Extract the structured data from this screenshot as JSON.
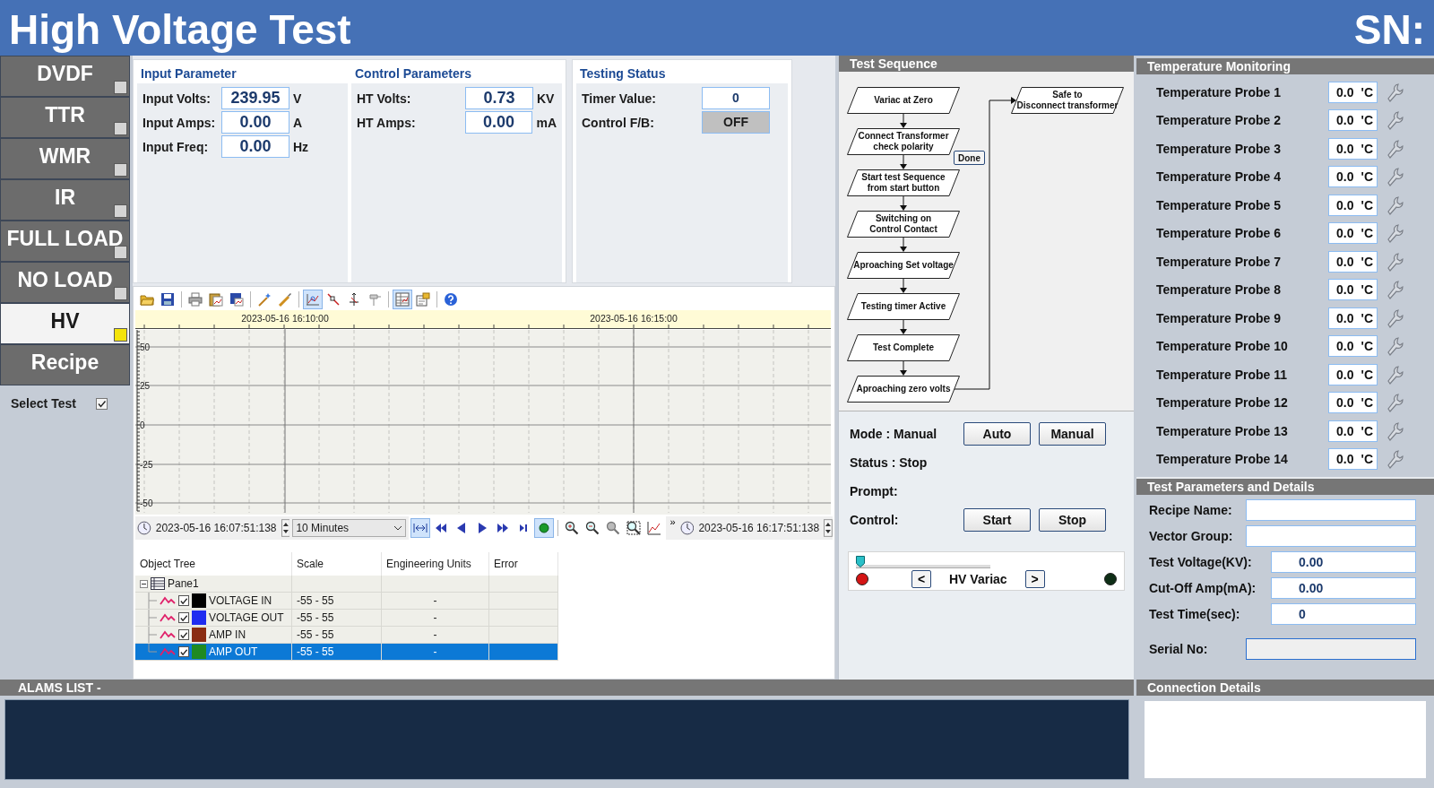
{
  "header": {
    "title": "High Voltage Test",
    "serial_label": "SN:"
  },
  "nav": {
    "items": [
      {
        "label": "DVDF",
        "kind": "test",
        "selected": false
      },
      {
        "label": "TTR",
        "kind": "test",
        "selected": false
      },
      {
        "label": "WMR",
        "kind": "test",
        "selected": false
      },
      {
        "label": "IR",
        "kind": "test",
        "selected": false
      },
      {
        "label": "FULL LOAD",
        "kind": "test",
        "selected": false
      },
      {
        "label": "NO LOAD",
        "kind": "test",
        "selected": false
      },
      {
        "label": "HV",
        "kind": "test",
        "selected": true
      },
      {
        "label": "Recipe",
        "kind": "page",
        "selected": false
      }
    ],
    "select_test": {
      "label": "Select Test",
      "checked": true
    }
  },
  "input_parameter": {
    "title": "Input Parameter",
    "rows": [
      {
        "label": "Input Volts:",
        "value": "239.95",
        "unit": "V"
      },
      {
        "label": "Input Amps:",
        "value": "0.00",
        "unit": "A"
      },
      {
        "label": "Input Freq:",
        "value": "0.00",
        "unit": "Hz"
      }
    ]
  },
  "control_parameters": {
    "title": "Control Parameters",
    "rows": [
      {
        "label": "HT Volts:",
        "value": "0.73",
        "unit": "KV"
      },
      {
        "label": "HT Amps:",
        "value": "0.00",
        "unit": "mA"
      }
    ]
  },
  "testing_status": {
    "title": "Testing Status",
    "rows": [
      {
        "label": "Timer Value:",
        "value": "0",
        "kind": "field"
      },
      {
        "label": "Control F/B:",
        "value": "OFF",
        "kind": "lamp",
        "on": false
      }
    ]
  },
  "trend": {
    "toolbar": [
      {
        "kind": "folder",
        "pressed": false,
        "sep": false
      },
      {
        "kind": "save",
        "pressed": false,
        "sep": false
      },
      {
        "kind": "printer",
        "pressed": false,
        "sep": true
      },
      {
        "kind": "clipboard",
        "pressed": false,
        "sep": false
      },
      {
        "kind": "diskchart",
        "pressed": false,
        "sep": false
      },
      {
        "kind": "wand",
        "pressed": false,
        "sep": true
      },
      {
        "kind": "pen",
        "pressed": false,
        "sep": false
      },
      {
        "kind": "cursor",
        "pressed": true,
        "sep": true
      },
      {
        "kind": "line",
        "pressed": false,
        "sep": false
      },
      {
        "kind": "axis",
        "pressed": false,
        "sep": false
      },
      {
        "kind": "pin",
        "pressed": false,
        "sep": false
      },
      {
        "kind": "table",
        "pressed": true,
        "sep": true
      },
      {
        "kind": "props",
        "pressed": false,
        "sep": false
      },
      {
        "kind": "help",
        "pressed": false,
        "sep": true
      }
    ],
    "time_labels": [
      "2023-05-16 16:10:00",
      "2023-05-16 16:15:00"
    ],
    "y_labels": [
      "50",
      "25",
      "0",
      "-25",
      "-50"
    ],
    "start_time": "2023-05-16 16:07:51:138",
    "range": "10 Minutes",
    "nav_buttons": [
      {
        "kind": "fit",
        "pressed": true,
        "sep": false
      },
      {
        "kind": "first",
        "pressed": false,
        "sep": false
      },
      {
        "kind": "prev",
        "pressed": false,
        "sep": false
      },
      {
        "kind": "next",
        "pressed": false,
        "sep": false
      },
      {
        "kind": "fast",
        "pressed": false,
        "sep": false
      },
      {
        "kind": "last",
        "pressed": false,
        "sep": false
      },
      {
        "kind": "live",
        "pressed": true,
        "sep": false
      },
      {
        "kind": "zoomin",
        "pressed": false,
        "sep": true
      },
      {
        "kind": "zoomout",
        "pressed": false,
        "sep": false
      },
      {
        "kind": "zoomkey",
        "pressed": false,
        "sep": false
      },
      {
        "kind": "zoombox",
        "pressed": false,
        "sep": false
      },
      {
        "kind": "chartfit",
        "pressed": false,
        "sep": false
      }
    ],
    "more": "»",
    "end_time": "2023-05-16 16:17:51:138",
    "tree": {
      "columns": [
        "Object Tree",
        "Scale",
        "Engineering Units",
        "Error"
      ],
      "root": {
        "label": "Pane1",
        "expanded": true,
        "children": [
          {
            "label": "VOLTAGE IN",
            "checked": true,
            "color": "#000000",
            "scale": "-55 - 55",
            "units": "-",
            "selected": false
          },
          {
            "label": "VOLTAGE OUT",
            "checked": true,
            "color": "#1f2cf0",
            "scale": "-55 - 55",
            "units": "-",
            "selected": false
          },
          {
            "label": "AMP IN",
            "checked": true,
            "color": "#8a2c12",
            "scale": "-55 - 55",
            "units": "-",
            "selected": false
          },
          {
            "label": "AMP OUT",
            "checked": true,
            "color": "#1f8a22",
            "scale": "-55 - 55",
            "units": "-",
            "selected": true
          }
        ]
      }
    }
  },
  "test_sequence": {
    "title": "Test Sequence",
    "steps": [
      "Variac at Zero",
      "Connect Transformer\ncheck polarity",
      "Start test Sequence\nfrom start button",
      "Switching on\nControl Contact",
      "Aproaching Set voltage",
      "Testing timer Active",
      "Test Complete",
      "Aproaching zero volts"
    ],
    "final_step": "Safe to\nDisconnect transformer",
    "done_button": "Done",
    "mode_label": "Mode : Manual",
    "mode_buttons": [
      "Auto",
      "Manual"
    ],
    "status": "Status : Stop",
    "prompt": "Prompt:",
    "control_label": "Control:",
    "control_buttons": [
      "Start",
      "Stop"
    ],
    "variac": {
      "label": "HV Variac",
      "level": 0,
      "down": "<",
      "up": ">",
      "lamps": [
        {
          "color": "#d41414"
        },
        {
          "color": "#0e2e16"
        }
      ]
    }
  },
  "temperature_monitoring": {
    "title": "Temperature Monitoring",
    "probes": [
      {
        "label": "Temperature Probe 1",
        "value": "0.0",
        "unit": "'C"
      },
      {
        "label": "Temperature Probe 2",
        "value": "0.0",
        "unit": "'C"
      },
      {
        "label": "Temperature Probe 3",
        "value": "0.0",
        "unit": "'C"
      },
      {
        "label": "Temperature Probe 4",
        "value": "0.0",
        "unit": "'C"
      },
      {
        "label": "Temperature Probe 5",
        "value": "0.0",
        "unit": "'C"
      },
      {
        "label": "Temperature Probe 6",
        "value": "0.0",
        "unit": "'C"
      },
      {
        "label": "Temperature Probe 7",
        "value": "0.0",
        "unit": "'C"
      },
      {
        "label": "Temperature Probe 8",
        "value": "0.0",
        "unit": "'C"
      },
      {
        "label": "Temperature Probe 9",
        "value": "0.0",
        "unit": "'C"
      },
      {
        "label": "Temperature Probe 10",
        "value": "0.0",
        "unit": "'C"
      },
      {
        "label": "Temperature Probe 11",
        "value": "0.0",
        "unit": "'C"
      },
      {
        "label": "Temperature Probe 12",
        "value": "0.0",
        "unit": "'C"
      },
      {
        "label": "Temperature Probe 13",
        "value": "0.0",
        "unit": "'C"
      },
      {
        "label": "Temperature Probe 14",
        "value": "0.0",
        "unit": "'C"
      }
    ]
  },
  "test_parameters": {
    "title": "Test Parameters and Details",
    "fields": [
      {
        "label": "Recipe Name:",
        "kind": "text",
        "disabled": false
      },
      {
        "label": "Vector Group:",
        "kind": "text",
        "disabled": false
      },
      {
        "label": "Test Voltage(KV):",
        "value": "0.00",
        "kind": "number",
        "disabled": false
      },
      {
        "label": "Cut-Off Amp(mA):",
        "value": "0.00",
        "kind": "number",
        "disabled": false
      },
      {
        "label": "Test Time(sec):",
        "value": "0",
        "kind": "number",
        "disabled": false
      },
      {
        "label": "Serial No:",
        "kind": "text",
        "disabled": true
      }
    ]
  },
  "alarms": {
    "title": "ALAMS LIST -"
  },
  "connection": {
    "title": "Connection Details"
  }
}
